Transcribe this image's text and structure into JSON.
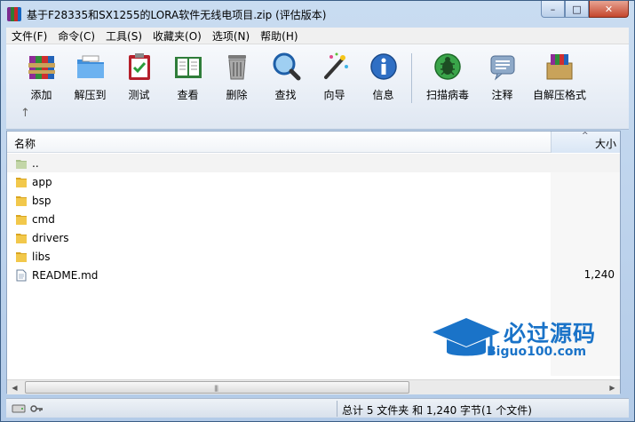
{
  "window": {
    "title": "基于F28335和SX1255的LORA软件无线电项目.zip (评估版本)",
    "controls": {
      "minimize": "–",
      "maximize": "□",
      "close": "✕"
    }
  },
  "menu": [
    "文件(F)",
    "命令(C)",
    "工具(S)",
    "收藏夹(O)",
    "选项(N)",
    "帮助(H)"
  ],
  "toolbar": {
    "buttons": [
      {
        "label": "添加",
        "icon": "add-archive-icon"
      },
      {
        "label": "解压到",
        "icon": "extract-folder-icon"
      },
      {
        "label": "测试",
        "icon": "test-clipboard-icon"
      },
      {
        "label": "查看",
        "icon": "view-book-icon"
      },
      {
        "label": "删除",
        "icon": "delete-trash-icon"
      },
      {
        "label": "查找",
        "icon": "find-magnifier-icon"
      },
      {
        "label": "向导",
        "icon": "wizard-wand-icon"
      },
      {
        "label": "信息",
        "icon": "info-icon"
      },
      {
        "label": "扫描病毒",
        "icon": "virus-scan-icon"
      },
      {
        "label": "注释",
        "icon": "comment-icon"
      },
      {
        "label": "自解压格式",
        "icon": "sfx-box-icon"
      }
    ],
    "up_arrow": "↑"
  },
  "file_list": {
    "columns": {
      "name": "名称",
      "size": "大小",
      "sort_indicator": "^"
    },
    "rows": [
      {
        "name": "..",
        "size": "",
        "type": "parent"
      },
      {
        "name": "app",
        "size": "",
        "type": "folder"
      },
      {
        "name": "bsp",
        "size": "",
        "type": "folder"
      },
      {
        "name": "cmd",
        "size": "",
        "type": "folder"
      },
      {
        "name": "drivers",
        "size": "",
        "type": "folder"
      },
      {
        "name": "libs",
        "size": "",
        "type": "folder"
      },
      {
        "name": "README.md",
        "size": "1,240",
        "type": "file"
      }
    ]
  },
  "status": {
    "text": "总计 5 文件夹 和 1,240 字节(1 个文件)"
  },
  "watermark": {
    "chinese": "必过源码",
    "url": "Biguo100.com"
  },
  "colors": {
    "accent": "#1a73c8",
    "folder": "#e8b934"
  }
}
